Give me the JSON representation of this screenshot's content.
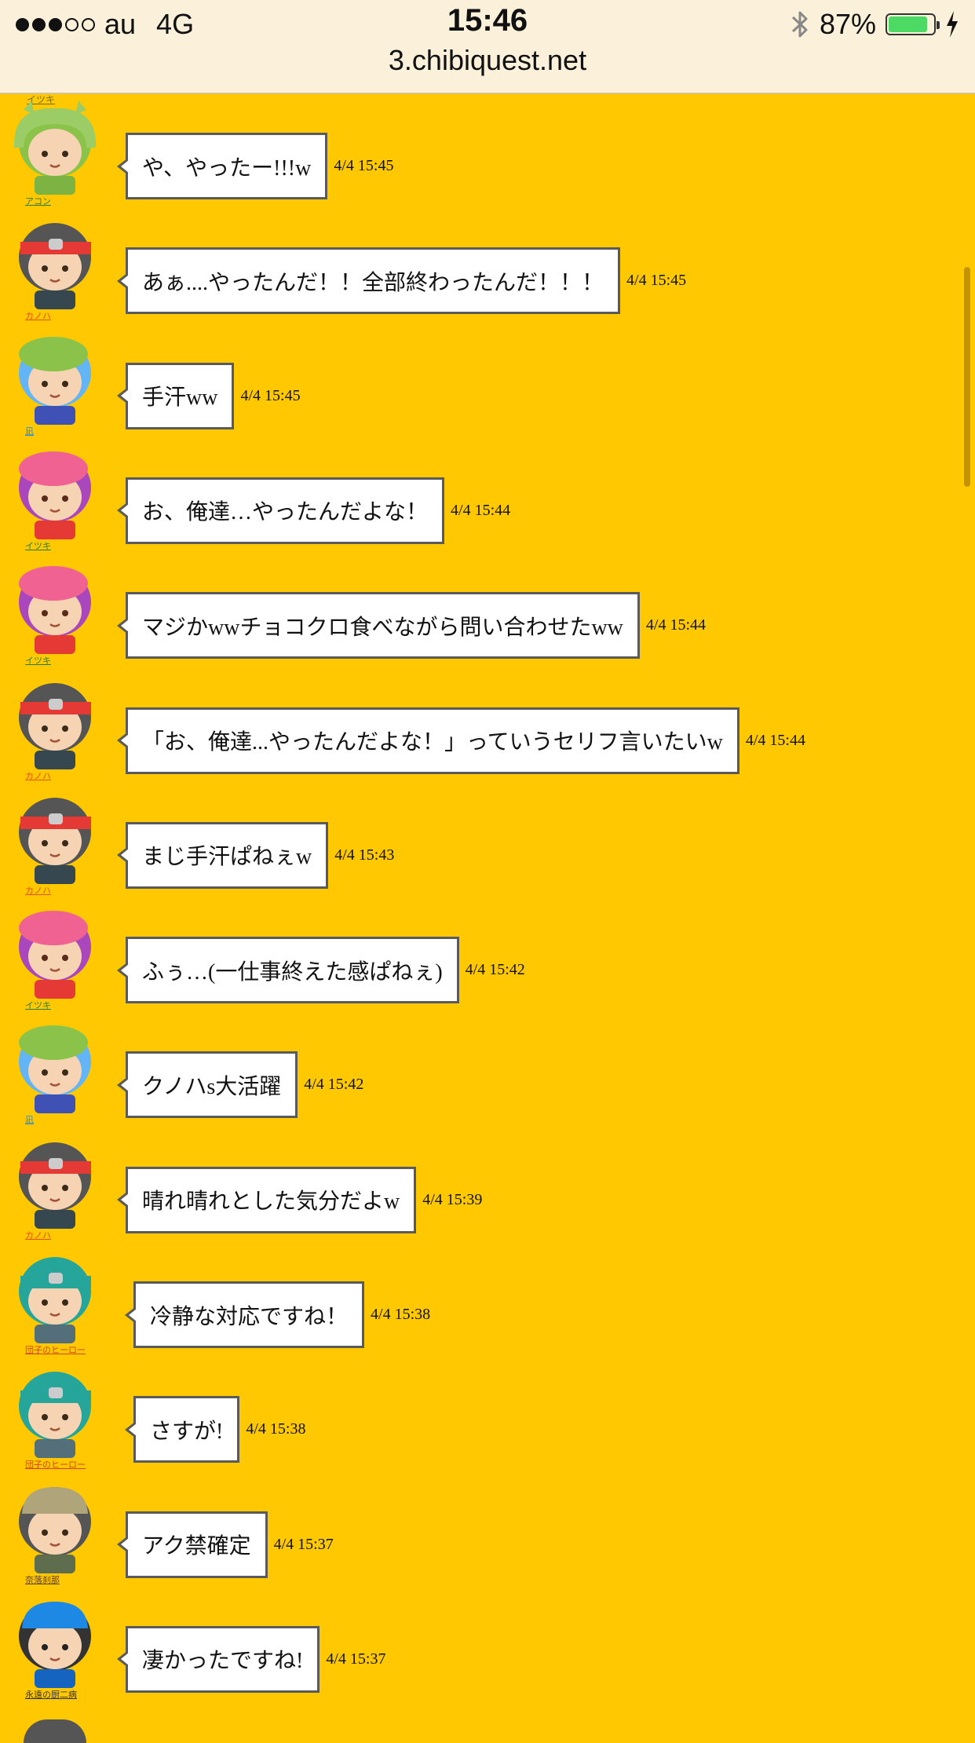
{
  "status_bar": {
    "carrier": "au",
    "network": "4G",
    "time": "15:46",
    "battery_percent": "87%",
    "battery_level": 0.87,
    "signal_bars": 3,
    "signal_max": 5
  },
  "browser": {
    "url": "3.chibiquest.net"
  },
  "colors": {
    "background": "#FFC800",
    "bubble_border": "#5a5a5a",
    "battery": "#4CD964"
  },
  "chat": {
    "top_partial_name": "イツキ",
    "messages": [
      {
        "avatar": "green-dragon-hood",
        "name": "アコン",
        "text": "や、やったー!!!w",
        "time": "4/4 15:45"
      },
      {
        "avatar": "red-headband-boy",
        "name": "カノハ",
        "text": "あぁ....やったんだ！！全部終わったんだ！！！",
        "time": "4/4 15:45"
      },
      {
        "avatar": "green-beret-girl",
        "name": "凪",
        "text": "手汗ww",
        "time": "4/4 15:45"
      },
      {
        "avatar": "pink-hat-girl",
        "name": "イツキ",
        "text": "お、俺達…やったんだよな！",
        "time": "4/4 15:44"
      },
      {
        "avatar": "pink-hat-girl",
        "name": "イツキ",
        "text": "マジかwwチョコクロ食べながら問い合わせたww",
        "time": "4/4 15:44"
      },
      {
        "avatar": "red-headband-boy",
        "name": "カノハ",
        "text": "「お、俺達...やったんだよな！」っていうセリフ言いたいw",
        "time": "4/4 15:44"
      },
      {
        "avatar": "red-headband-boy",
        "name": "カノハ",
        "text": "まじ手汗ぱねぇw",
        "time": "4/4 15:43"
      },
      {
        "avatar": "pink-hat-girl",
        "name": "イツキ",
        "text": "ふぅ…(一仕事終えた感ぱねぇ)",
        "time": "4/4 15:42"
      },
      {
        "avatar": "green-beret-girl",
        "name": "凪",
        "text": "クノハs大活躍",
        "time": "4/4 15:42"
      },
      {
        "avatar": "red-headband-boy",
        "name": "カノハ",
        "text": "晴れ晴れとした気分だよw",
        "time": "4/4 15:39"
      },
      {
        "avatar": "teal-hair-hero",
        "name": "団子のヒーロー",
        "text": "冷静な対応ですね！",
        "time": "4/4 15:38"
      },
      {
        "avatar": "teal-hair-hero",
        "name": "団子のヒーロー",
        "text": "さすが!",
        "time": "4/4 15:38"
      },
      {
        "avatar": "khaki-cap-glasses",
        "name": "奈落刹那",
        "text": "アク禁確定",
        "time": "4/4 15:37"
      },
      {
        "avatar": "blue-cap-eyepatch",
        "name": "永遠の厨二病",
        "text": "凄かったですね!",
        "time": "4/4 15:37"
      }
    ]
  }
}
